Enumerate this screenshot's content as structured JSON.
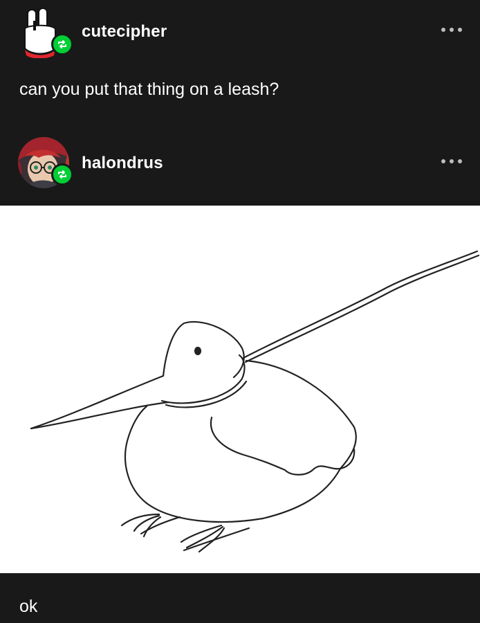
{
  "posts": [
    {
      "username": "cutecipher",
      "text": "can you put that thing on a leash?",
      "avatar_icon": "bunny-avatar-icon",
      "badge_icon": "reblog-icon"
    },
    {
      "username": "halondrus",
      "avatar_icon": "character-avatar-icon",
      "badge_icon": "reblog-icon",
      "image_description_icon": "kiwi-bird-on-leash-drawing",
      "text": "ok"
    }
  ],
  "colors": {
    "background": "#191919",
    "reblog_badge": "#00cf35",
    "text": "#ffffff",
    "more_dots": "#bdbdbd"
  }
}
